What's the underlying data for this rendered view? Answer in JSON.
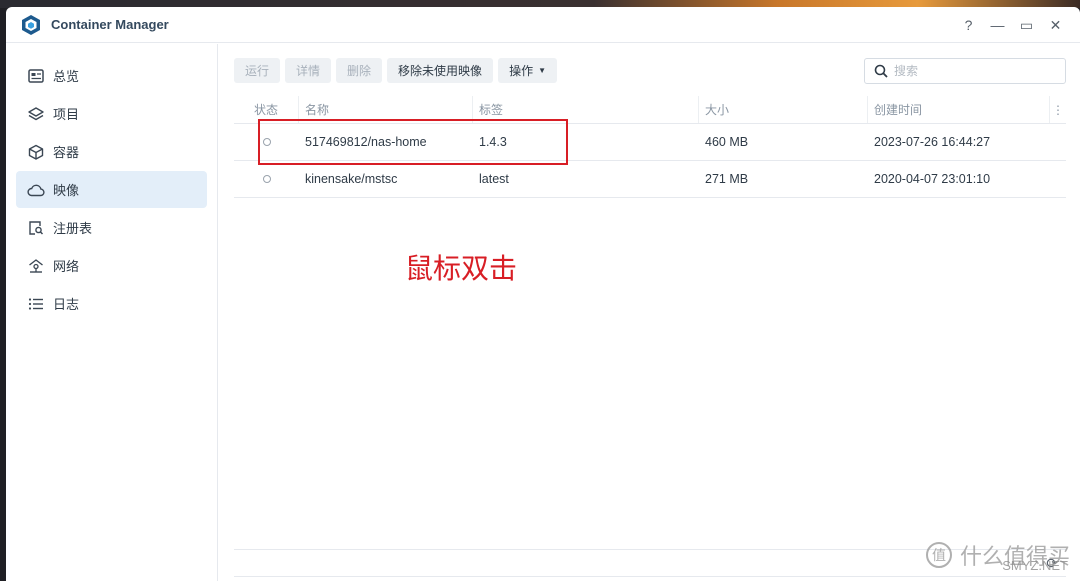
{
  "window": {
    "title": "Container Manager",
    "controls": {
      "help": "?",
      "minimize": "—",
      "maximize": "▭",
      "close": "✕"
    }
  },
  "sidebar": {
    "items": [
      {
        "label": "总览",
        "icon": "overview-icon"
      },
      {
        "label": "项目",
        "icon": "layers-icon"
      },
      {
        "label": "容器",
        "icon": "cube-icon"
      },
      {
        "label": "映像",
        "icon": "cloud-icon",
        "active": true
      },
      {
        "label": "注册表",
        "icon": "registry-search-icon"
      },
      {
        "label": "网络",
        "icon": "network-home-icon"
      },
      {
        "label": "日志",
        "icon": "list-icon"
      }
    ]
  },
  "toolbar": {
    "run": "运行",
    "details": "详情",
    "delete": "删除",
    "remove_unused": "移除未使用映像",
    "actions": "操作"
  },
  "search": {
    "placeholder": "搜索"
  },
  "table": {
    "headers": {
      "status": "状态",
      "name": "名称",
      "tag": "标签",
      "size": "大小",
      "created": "创建时间"
    },
    "rows": [
      {
        "name": "517469812/nas-home",
        "tag": "1.4.3",
        "size": "460 MB",
        "created": "2023-07-26 16:44:27"
      },
      {
        "name": "kinensake/mstsc",
        "tag": "latest",
        "size": "271 MB",
        "created": "2020-04-07 23:01:10"
      }
    ]
  },
  "annotation": {
    "text": "鼠标双击",
    "color": "#d81e25"
  },
  "watermark": {
    "text": "什么值得买",
    "site": "SMYZ.NET"
  },
  "colors": {
    "active_nav": "#e3eef9",
    "accent": "#1e6fb8",
    "annotation_red": "#d81e25"
  }
}
